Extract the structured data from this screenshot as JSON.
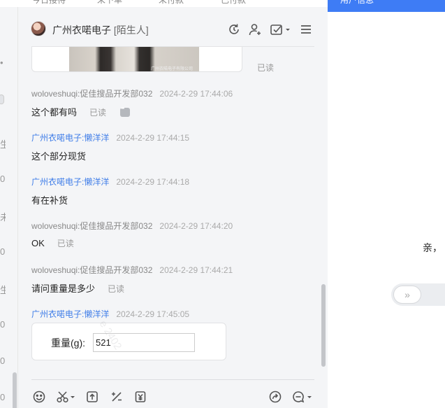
{
  "top_tabs": [
    "今日接待",
    "未下单",
    "未付款",
    "已付款"
  ],
  "left_strip_glyphs": [
    "•",
    "生",
    "0",
    "未",
    "0",
    "生",
    "0",
    "0",
    "0"
  ],
  "header": {
    "title": "广州衣喏电子",
    "tag": "[陌生人]",
    "icons": [
      "refresh-icon",
      "user-add-icon",
      "task-check-icon",
      "menu-icon"
    ]
  },
  "messages": {
    "image_read": "已读",
    "image_watermark": "广州衣喏电子有限公司",
    "items": [
      {
        "sender": "woloveshuqi:促佳搜品开发部032",
        "time": "2024-2-29 17:44:06",
        "text": "这个都有吗",
        "read": "已读",
        "self": false
      },
      {
        "sender": "广州衣喏电子:懒洋洋",
        "time": "2024-2-29 17:44:15",
        "text": "这个部分现货",
        "read": "",
        "self": true
      },
      {
        "sender": "广州衣喏电子:懒洋洋",
        "time": "2024-2-29 17:44:18",
        "text": "有在补货",
        "read": "",
        "self": true
      },
      {
        "sender": "woloveshuqi:促佳搜品开发部032",
        "time": "2024-2-29 17:44:20",
        "text": "OK",
        "read": "已读",
        "self": false
      },
      {
        "sender": "woloveshuqi:促佳搜品开发部032",
        "time": "2024-2-29 17:44:21",
        "text": "请问重量是多少",
        "read": "已读",
        "self": false
      },
      {
        "sender": "广州衣喏电子:懒洋洋",
        "time": "2024-2-29 17:45:05",
        "text": "",
        "read": "",
        "self": true
      }
    ],
    "form": {
      "label": "重量(g):",
      "value": "521"
    },
    "watermark": "e 2402"
  },
  "toolbar": {
    "icons": [
      "emoji-icon",
      "scissors-icon",
      "upload-icon",
      "calculator-icon",
      "yuan-coupon-icon",
      "share-icon",
      "quick-reply-icon"
    ]
  },
  "right_panel": {
    "header": "用户信息",
    "greeting": "亲，"
  },
  "colors": {
    "accent": "#3e7cf5",
    "self_sender": "#3f7de8"
  }
}
